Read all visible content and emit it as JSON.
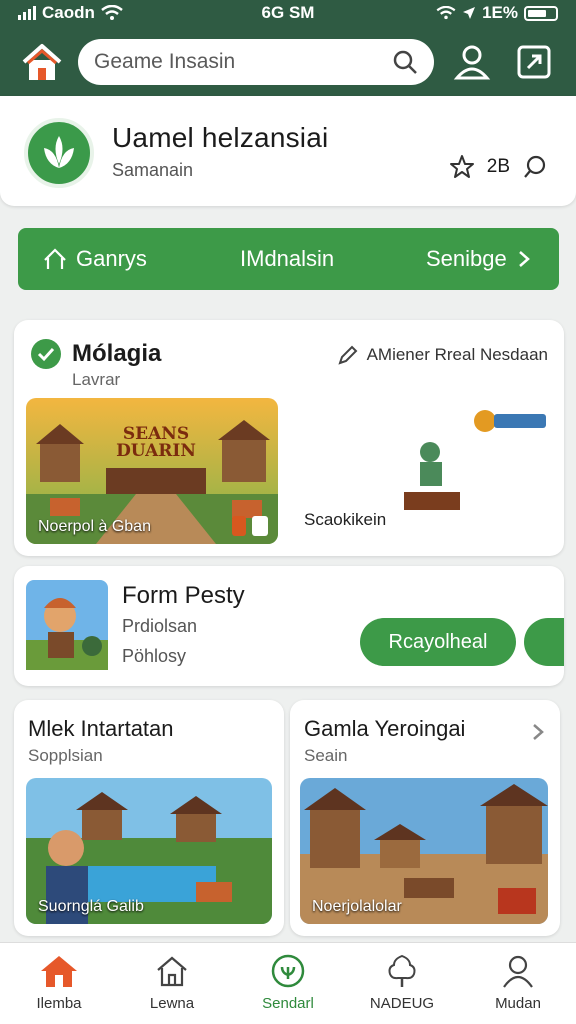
{
  "status": {
    "carrier": "Caodn",
    "time": "6G SM",
    "battery": "1E%"
  },
  "header": {
    "search_placeholder": "Geame Insasin"
  },
  "profile": {
    "title": "Uamel helzansiai",
    "subtitle": "Samanain",
    "rating": "2B"
  },
  "tabs": [
    {
      "label": "Ganrys"
    },
    {
      "label": "IMdnalsin"
    },
    {
      "label": "Senibge"
    }
  ],
  "section1": {
    "title": "Mólagia",
    "subtitle": "Lavrar",
    "link": "AMiener Rreal Nesdaan",
    "tiles": [
      {
        "title_art": "SEANS DUARIN",
        "caption": "Noerpol à Gban"
      },
      {
        "caption": "Scaokikein"
      }
    ]
  },
  "section2": {
    "title": "Form Pesty",
    "line1": "Prdiolsan",
    "line2": "Pöhlosy",
    "button": "Rcayolheal"
  },
  "section3": [
    {
      "title": "Mlek Intartatan",
      "subtitle": "Sopplsian",
      "caption": "Suornglá Galib"
    },
    {
      "title": "Gamla Yeroingai",
      "subtitle": "Seain",
      "caption": "Noerjolalolar"
    }
  ],
  "bottom_nav": [
    {
      "label": "Ilemba",
      "active": true
    },
    {
      "label": "Lewna"
    },
    {
      "label": "Sendarl"
    },
    {
      "label": "NADEUG"
    },
    {
      "label": "Mudan"
    }
  ],
  "colors": {
    "header": "#2f5b43",
    "accent": "#3d9a48",
    "home_icon": "#e6582a"
  }
}
